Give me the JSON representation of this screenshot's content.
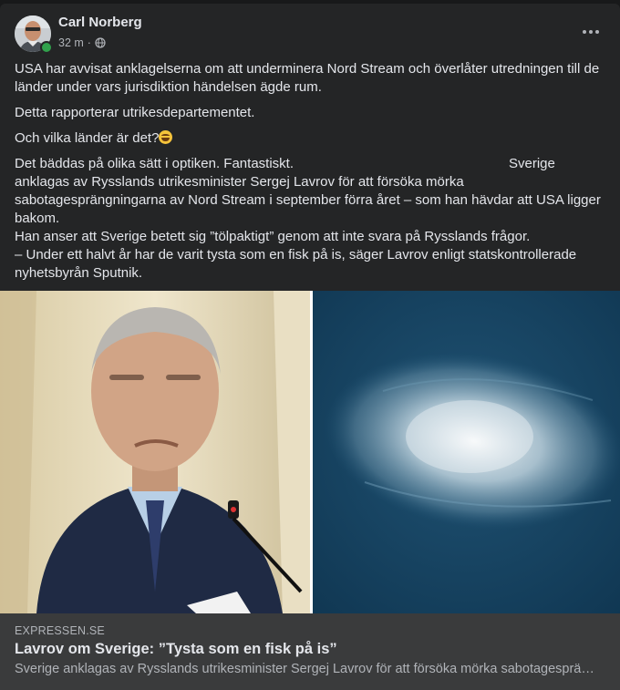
{
  "post": {
    "author": "Carl Norberg",
    "time": "32 m",
    "separator": "·",
    "privacy_icon": "globe-icon",
    "more_icon": "more-options-icon",
    "paragraphs": [
      "USA har avvisat anklagelserna om att underminera Nord Stream och överlåter utredningen till de länder under vars jurisdiktion händelsen ägde rum.",
      "Detta rapporterar utrikesdepartementet.",
      "Och vilka länder är det?"
    ],
    "emoji_icon": "laughing-emoji-icon",
    "commentary": {
      "line1_start": "Det bäddas på olika sätt i optiken. Fantastiskt.",
      "line1_end": "Sverige",
      "line2": "anklagas av Rysslands utrikesminister Sergej Lavrov för att försöka mörka sabotagesprängningarna av Nord Stream i september förra året – som han hävdar att USA ligger bakom.",
      "line3": "Han anser att Sverige betett sig ”tölpaktigt” genom att inte svara på Rysslands frågor.",
      "line4": "– Under ett halvt år har de varit tysta som en fisk på is, säger Lavrov enligt statskontrollerade nyhetsbyrån Sputnik."
    }
  },
  "link_preview": {
    "domain": "EXPRESSEN.SE",
    "title": "Lavrov om Sverige: ”Tysta som en fisk på is”",
    "description": "Sverige anklagas av Rysslands utrikesminister Sergej Lavrov för att försöka mörka sabotagesprängningarna av Nord Stream i september förra året"
  },
  "colors": {
    "card_background": "#242526",
    "link_card_background": "#3a3b3c",
    "primary_text": "#e4e6eb",
    "secondary_text": "#b0b3b8",
    "online_status": "#31a24c"
  }
}
